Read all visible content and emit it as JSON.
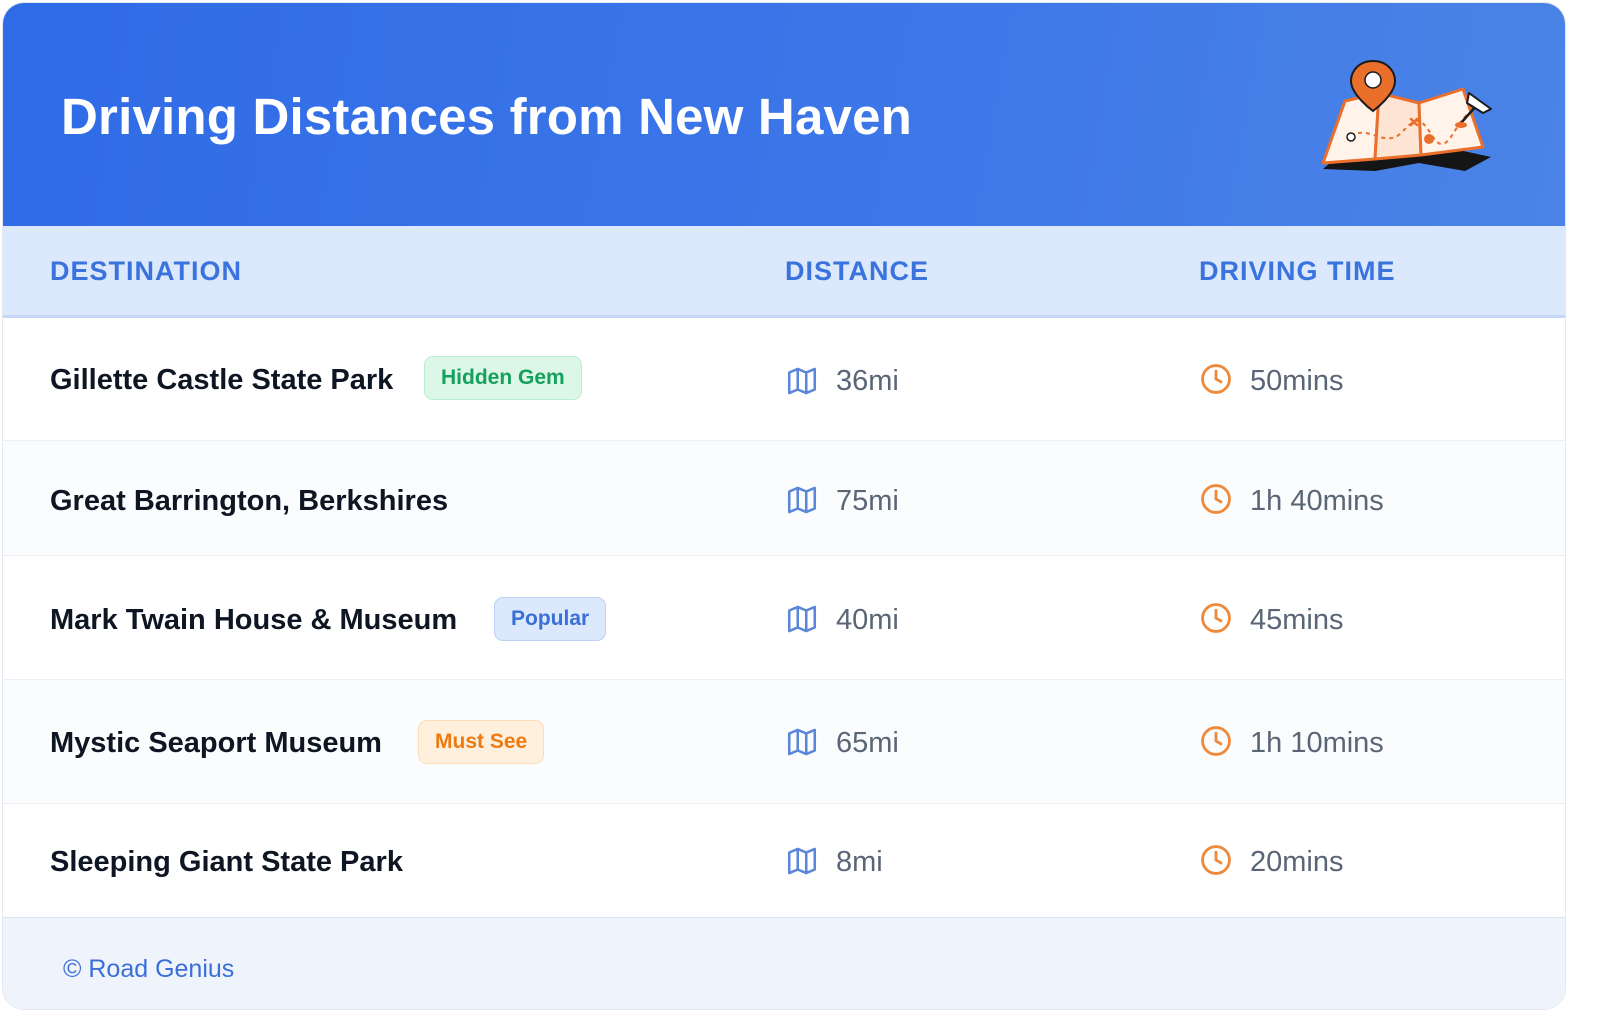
{
  "header": {
    "title": "Driving Distances from New Haven",
    "illustration": "map-with-pin-icon"
  },
  "columns": {
    "destination": "DESTINATION",
    "distance": "DISTANCE",
    "driving_time": "DRIVING TIME"
  },
  "rows": [
    {
      "destination": "Gillette Castle State Park",
      "badge": "Hidden Gem",
      "badge_color": "#16a05d",
      "distance": "36mi",
      "time": "50mins"
    },
    {
      "destination": "Great Barrington, Berkshires",
      "badge": "",
      "distance": "75mi",
      "time": "1h 40mins"
    },
    {
      "destination": "Mark Twain House & Museum",
      "badge": "Popular",
      "badge_color": "#3a6fd6",
      "distance": "40mi",
      "time": "45mins"
    },
    {
      "destination": "Mystic Seaport Museum",
      "badge": "Must See",
      "badge_color": "#ee7a12",
      "distance": "65mi",
      "time": "1h 10mins"
    },
    {
      "destination": "Sleeping Giant State Park",
      "badge": "",
      "distance": "8mi",
      "time": "20mins"
    }
  ],
  "icons": {
    "distance": "map-icon",
    "time": "clock-icon"
  },
  "colors": {
    "header_gradient_start": "#2f6be6",
    "header_gradient_end": "#4b84e6",
    "accent_blue": "#3a73de",
    "accent_orange": "#ee8a3c"
  },
  "footer": {
    "text": "© Road Genius"
  }
}
